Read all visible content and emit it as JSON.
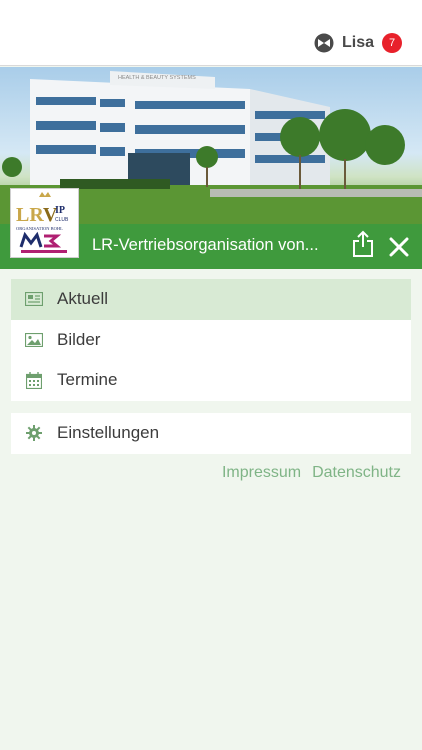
{
  "header": {
    "user_name": "Lisa",
    "notification_count": "7"
  },
  "group": {
    "title": "LR-Vertriebsorganisation von...",
    "logo_text": {
      "line1": "LR VIP CLUB",
      "line2": "ORGANISATION BOHL",
      "line3": "M3"
    },
    "photo_sign": "HEALTH & BEAUTY SYSTEMS"
  },
  "menu": {
    "items": [
      {
        "label": "Aktuell",
        "icon": "newspaper-icon",
        "active": true
      },
      {
        "label": "Bilder",
        "icon": "image-icon",
        "active": false
      },
      {
        "label": "Termine",
        "icon": "calendar-icon",
        "active": false
      }
    ],
    "settings": {
      "label": "Einstellungen",
      "icon": "gear-icon"
    }
  },
  "footer": {
    "impressum": "Impressum",
    "datenschutz": "Datenschutz"
  },
  "colors": {
    "accent": "#3f9a3d",
    "active_bg": "#d8ead4",
    "page_bg": "#f0f6ee",
    "badge": "#e8212b",
    "link": "#7fb486"
  }
}
